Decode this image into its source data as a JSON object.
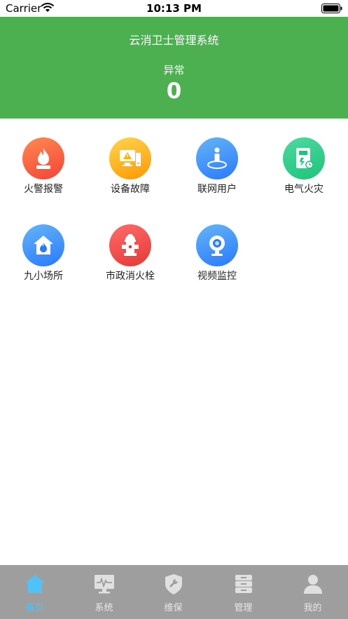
{
  "status": {
    "carrier": "Carrier",
    "time": "10:13 PM"
  },
  "header": {
    "title": "云消卫士管理系统",
    "stat_label": "异常",
    "stat_value": "0"
  },
  "grid": [
    {
      "label": "火警报警",
      "icon": "fire-alarm-icon",
      "color_from": "#ff8a50",
      "color_to": "#f44336"
    },
    {
      "label": "设备故障",
      "icon": "device-fault-icon",
      "color_from": "#ffd54f",
      "color_to": "#ff9800"
    },
    {
      "label": "联网用户",
      "icon": "network-user-icon",
      "color_from": "#64b5f6",
      "color_to": "#2979ff"
    },
    {
      "label": "电气火灾",
      "icon": "electrical-fire-icon",
      "color_from": "#4dd9a0",
      "color_to": "#1ec47a"
    },
    {
      "label": "九小场所",
      "icon": "small-venue-icon",
      "color_from": "#64b5f6",
      "color_to": "#2979ff"
    },
    {
      "label": "市政消火栓",
      "icon": "hydrant-icon",
      "color_from": "#ff6b6b",
      "color_to": "#e53935"
    },
    {
      "label": "视频监控",
      "icon": "camera-icon",
      "color_from": "#64b5f6",
      "color_to": "#2979ff"
    }
  ],
  "tabs": [
    {
      "label": "首页",
      "icon": "home-icon",
      "active": true
    },
    {
      "label": "系统",
      "icon": "monitor-icon",
      "active": false
    },
    {
      "label": "维保",
      "icon": "wrench-shield-icon",
      "active": false
    },
    {
      "label": "管理",
      "icon": "cabinet-icon",
      "active": false
    },
    {
      "label": "我的",
      "icon": "user-icon",
      "active": false
    }
  ],
  "colors": {
    "header_bg": "#4caf50",
    "tabbar_bg": "#9e9e9e",
    "tab_active": "#4fc3f7"
  }
}
